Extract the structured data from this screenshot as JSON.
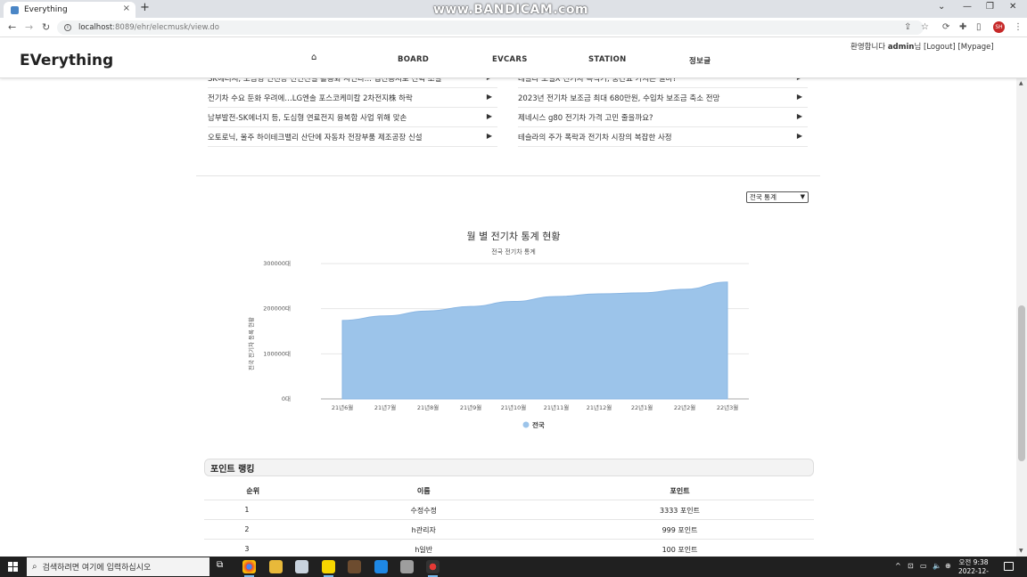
{
  "browser": {
    "tab_title": "Everything",
    "tab_close": "×",
    "new_tab": "+",
    "url_host": "localhost",
    "url_path": ":8089/ehr/elecmusk/view.do",
    "watermark": "www.BANDICAM.com",
    "profile_initials": "SH"
  },
  "header": {
    "logo": "EVerything",
    "nav": [
      "BOARD",
      "EVCARS",
      "STATION",
      "정보글"
    ],
    "welcome": "환영합니다",
    "username": "admin",
    "suffix": "님",
    "logout": "[Logout]",
    "mypage": "[Mypage]"
  },
  "news": {
    "left": [
      "SK에너지, 모임형 인천등 전인전철 활용화 시인다... 업전용지로 전력 조절",
      "전기차 수요 둔화 우려에…LG엔솔 포스코케미칼 2차전지株 하락",
      "남부발전-SK에너지 등, 도심형 연료전지 융복합 사업 위해 맞손",
      "오토로닉, 울주 하이테크밸리 산단에 자동차 전장부품 제조공장 신설"
    ],
    "right": [
      "테슬라 모델X 전기차 목적기, 중간요 가치는 얼마?",
      "2023년 전기차 보조금 최대 680만원, 수입차 보조금 축소 전망",
      "제네시스 g80 전기차 가격 고민 줄을까요?",
      "테슬라의 주가 폭락과 전기차 시장의 복잡한 사정"
    ]
  },
  "stats_select": {
    "selected": "전국 통계"
  },
  "chart_data": {
    "type": "area",
    "title": "월 별 전기차 통계 현황",
    "subtitle": "전국 전기차 통계",
    "ylabel": "전국 전기차 등록 현황",
    "categories": [
      "21년6월",
      "21년7월",
      "21년8월",
      "21년9월",
      "21년10월",
      "21년11월",
      "21년12월",
      "22년1월",
      "22년2월",
      "22년3월"
    ],
    "series": [
      {
        "name": "전국",
        "values": [
          174000,
          184000,
          195000,
          205000,
          216000,
          227000,
          233000,
          235000,
          243000,
          259000
        ],
        "color": "#9cc4ea"
      }
    ],
    "yticks": [
      "0대",
      "100000대",
      "200000대",
      "300000대"
    ],
    "ylim": [
      0,
      300000
    ],
    "grid": true,
    "legend": "bottom"
  },
  "ranking": {
    "title": "포인트 랭킹",
    "headers": [
      "순위",
      "이름",
      "포인트"
    ],
    "rows": [
      [
        "1",
        "수정수정",
        "3333 포인트"
      ],
      [
        "2",
        "h관리자",
        "999 포인트"
      ],
      [
        "3",
        "h일반",
        "100 포인트"
      ]
    ]
  },
  "taskbar": {
    "search_placeholder": "검색하려면 여기에 입력하십시오",
    "time": "오전 9:38",
    "date": "2022-12-28"
  }
}
